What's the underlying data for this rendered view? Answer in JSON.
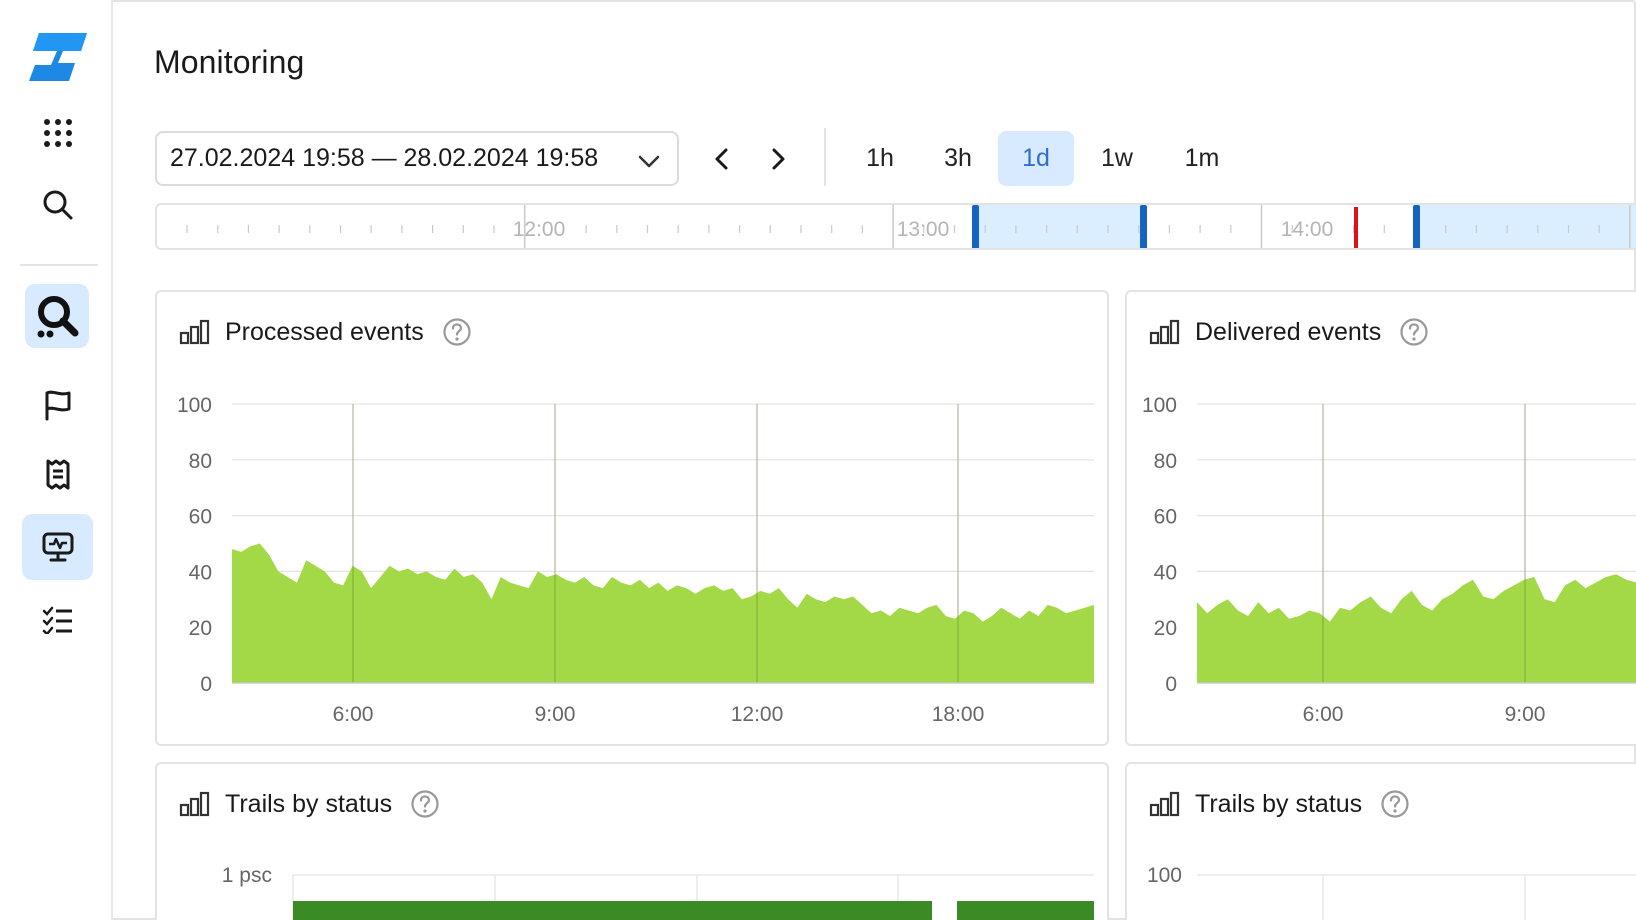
{
  "page": {
    "title": "Monitoring"
  },
  "sidebar": {
    "items": [
      {
        "name": "logo",
        "icon": "brand-logo-icon"
      },
      {
        "name": "apps",
        "icon": "grid-dots-icon"
      },
      {
        "name": "search",
        "icon": "search-icon"
      },
      {
        "name": "service",
        "icon": "audit-trails-icon",
        "active": true
      },
      {
        "name": "flag",
        "icon": "flag-icon"
      },
      {
        "name": "receipt",
        "icon": "receipt-icon"
      },
      {
        "name": "monitoring",
        "icon": "monitor-chart-icon",
        "active": true
      },
      {
        "name": "checklist",
        "icon": "checklist-icon"
      }
    ]
  },
  "toolbar": {
    "range_text": "27.02.2024 19:58 — 28.02.2024 19:58",
    "periods": [
      "1h",
      "3h",
      "1d",
      "1w",
      "1m"
    ],
    "active_period": "1d"
  },
  "timeline": {
    "labels": [
      "12:00",
      "13:00",
      "14:00"
    ],
    "selection_color": "#dbeeff",
    "handle_color": "#1565c0",
    "now_color": "#e0101a"
  },
  "colors": {
    "accent": "#2f6fd1",
    "series_green": "#a3d946",
    "series_dark_green": "#3a8a26",
    "grid": "#e3e3e3"
  },
  "panels": [
    {
      "title": "Processed events"
    },
    {
      "title": "Delivered events"
    },
    {
      "title": "Trails by status"
    },
    {
      "title": "Trails by status"
    }
  ],
  "chart_data": [
    {
      "type": "area",
      "title": "Processed events",
      "x_ticks": [
        "6:00",
        "9:00",
        "12:00",
        "18:00"
      ],
      "y_ticks": [
        "100",
        "80",
        "60",
        "40",
        "20",
        "0"
      ],
      "ylim": [
        0,
        100
      ],
      "grid": true,
      "series": [
        {
          "values": [
            48,
            47,
            49,
            50,
            46,
            40,
            38,
            36,
            44,
            42,
            40,
            36,
            35,
            42,
            40,
            34,
            38,
            42,
            40,
            41,
            39,
            40,
            38,
            37,
            41,
            38,
            39,
            36,
            30,
            38,
            36,
            35,
            34,
            40,
            38,
            39,
            37,
            36,
            38,
            35,
            34,
            38,
            36,
            35,
            37,
            34,
            36,
            33,
            35,
            34,
            32,
            34,
            35,
            33,
            34,
            30,
            31,
            33,
            32,
            34,
            30,
            27,
            32,
            30,
            29,
            31,
            30,
            31,
            28,
            25,
            26,
            24,
            27,
            26,
            25,
            27,
            28,
            24,
            23,
            26,
            25,
            22,
            24,
            27,
            25,
            23,
            26,
            24,
            28,
            27,
            25,
            26,
            27,
            28
          ]
        }
      ]
    },
    {
      "type": "area",
      "title": "Delivered events",
      "x_ticks": [
        "6:00",
        "9:00"
      ],
      "y_ticks": [
        "100",
        "80",
        "60",
        "40",
        "20",
        "0"
      ],
      "ylim": [
        0,
        100
      ],
      "grid": true,
      "series": [
        {
          "values": [
            29,
            25,
            28,
            30,
            26,
            24,
            29,
            25,
            27,
            23,
            24,
            26,
            25,
            22,
            27,
            26,
            29,
            31,
            27,
            25,
            30,
            33,
            28,
            26,
            30,
            32,
            35,
            37,
            31,
            30,
            33,
            35,
            37,
            38,
            30,
            29,
            35,
            37,
            34,
            36,
            38,
            39,
            37,
            36,
            38,
            39
          ]
        }
      ]
    },
    {
      "type": "bar",
      "title": "Trails by status",
      "y_ticks": [
        "1 psc"
      ],
      "grid": true,
      "series": [
        {
          "values": [
            1,
            0,
            1
          ]
        }
      ]
    },
    {
      "type": "area",
      "title": "Trails by status",
      "y_ticks": [
        "100"
      ],
      "grid": true,
      "series": []
    }
  ]
}
